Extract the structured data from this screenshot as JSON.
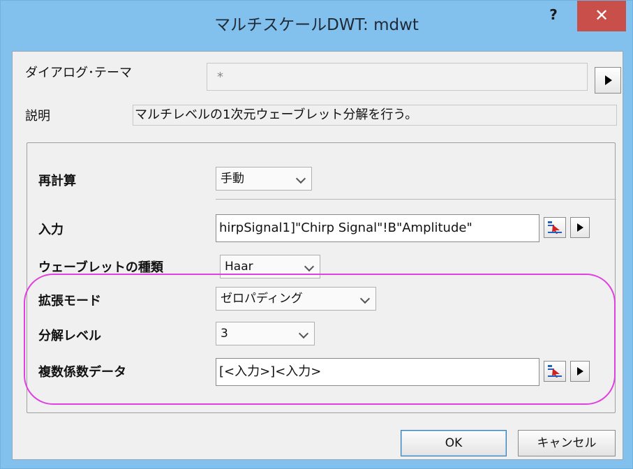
{
  "window": {
    "title": "マルチスケールDWT: mdwt",
    "help_label": "?",
    "close_label": "✕"
  },
  "dialog_theme": {
    "label": "ダイアログ･テーマ",
    "value": "*"
  },
  "description": {
    "label": "説明",
    "text": "マルチレベルの1次元ウェーブレット分解を行う。"
  },
  "recalc": {
    "label": "再計算",
    "value": "手動"
  },
  "input": {
    "label": "入力",
    "value": "hirpSignal1]\"Chirp Signal\"!B\"Amplitude\""
  },
  "wavelet_type": {
    "label": "ウェーブレットの種類",
    "value": "Haar"
  },
  "extension_mode": {
    "label": "拡張モード",
    "value": "ゼロパディング"
  },
  "decomp_level": {
    "label": "分解レベル",
    "value": "3"
  },
  "coef_data": {
    "label": "複数係数データ",
    "value": "[<入力>]<入力>"
  },
  "buttons": {
    "ok": "OK",
    "cancel": "キャンセル"
  },
  "colors": {
    "titlebar": "#82c1ed",
    "close": "#c9504a",
    "highlight": "#e040e0"
  }
}
